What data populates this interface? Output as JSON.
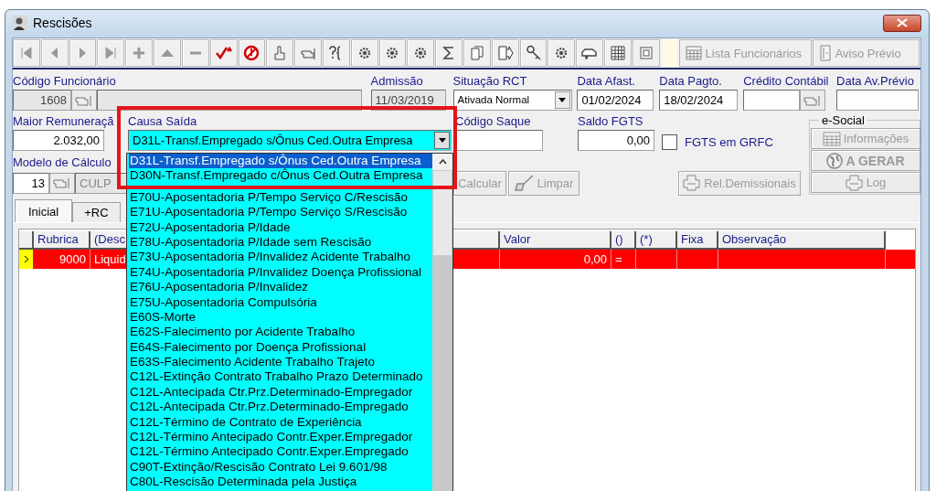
{
  "window": {
    "title": "Rescisões"
  },
  "toolbar": {
    "buttons": [
      {
        "label": "Lista Funcionários",
        "disabled": true
      },
      {
        "label": "Aviso Prévio",
        "disabled": true
      }
    ]
  },
  "codigo_funcionario": {
    "label": "Código Funcionário",
    "value": "1608"
  },
  "admissao": {
    "label": "Admissão",
    "value": "11/03/2019"
  },
  "situacao_rct": {
    "label": "Situação RCT",
    "value": "Ativada Normal"
  },
  "data_afast": {
    "label": "Data Afast.",
    "value": "01/02/2024"
  },
  "data_pagto": {
    "label": "Data Pagto.",
    "value": "18/02/2024"
  },
  "credito_contabil": {
    "label": "Crédito Contábil"
  },
  "data_av_previo": {
    "label": "Data Av.Prévio"
  },
  "maior_remuneracao": {
    "label": "Maior Remuneraçã",
    "value": "2.032,00"
  },
  "causa_saida": {
    "label": "Causa Saída",
    "value": "D31L-Transf.Empregado s/Ônus Ced.Outra Empresa",
    "expanded": true,
    "options": [
      {
        "label": "D31L-Transf.Empregado s/Ônus Ced.Outra Empresa",
        "selected": true
      },
      {
        "label": "D30N-Transf.Empregado c/Ônus Ced.Outra Empresa",
        "selected": false
      },
      {
        "label": "E70U-Aposentadoria P/Tempo Serviço C/Rescisão",
        "selected": false
      },
      {
        "label": "E71U-Aposentadoria P/Tempo Serviço S/Rescisão",
        "selected": false
      },
      {
        "label": "E72U-Aposentadoria P/Idade",
        "selected": false
      },
      {
        "label": "E78U-Aposentadoria P/Idade sem Rescisão",
        "selected": false
      },
      {
        "label": "E73U-Aposentadoria P/Invalidez Acidente Trabalho",
        "selected": false
      },
      {
        "label": "E74U-Aposentadoria P/Invalidez Doença Profissional",
        "selected": false
      },
      {
        "label": "E76U-Aposentadoria P/Invalidez",
        "selected": false
      },
      {
        "label": "E75U-Aposentadoria Compulsória",
        "selected": false
      },
      {
        "label": "E60S-Morte",
        "selected": false
      },
      {
        "label": "E62S-Falecimento por Acidente Trabalho",
        "selected": false
      },
      {
        "label": "E64S-Falecimento por Doença Profissional",
        "selected": false
      },
      {
        "label": "E63S-Falecimento Acidente Trabalho Trajeto",
        "selected": false
      },
      {
        "label": "C12L-Extinção Contrato Trabalho Prazo Determinado",
        "selected": false
      },
      {
        "label": "C12L-Antecipada Ctr.Prz.Determinado-Empregador",
        "selected": false
      },
      {
        "label": "C12L-Antecipada Ctr.Prz.Determinado-Empregado",
        "selected": false
      },
      {
        "label": "C12L-Término de Contrato de Experiência",
        "selected": false
      },
      {
        "label": "C12L-Término Antecipado Contr.Exper.Empregador",
        "selected": false
      },
      {
        "label": "C12L-Término Antecipado Contr.Exper.Empregado",
        "selected": false
      },
      {
        "label": "C90T-Extinção/Rescisão Contrato Lei 9.601/98",
        "selected": false
      },
      {
        "label": "C80L-Rescisão Determinada pela Justiça",
        "selected": false
      }
    ]
  },
  "codigo_saque": {
    "label": "Código Saque"
  },
  "saldo_fgts": {
    "label": "Saldo FGTS",
    "value": "0,00"
  },
  "fgts_grfc": {
    "label": "FGTS em GRFC",
    "checked": false
  },
  "e_social": {
    "title": "e-Social",
    "buttons": [
      {
        "label": "Informações",
        "disabled": true
      },
      {
        "label": "A GERAR",
        "disabled": true
      },
      {
        "label": "Log",
        "disabled": true
      }
    ]
  },
  "modelo_calculo": {
    "label": "Modelo de Cálculo",
    "value": "13",
    "description": "CULP"
  },
  "actions": [
    {
      "label": "Calcular",
      "disabled": true
    },
    {
      "label": "Limpar",
      "disabled": true
    },
    {
      "label": "Rel.Demissionais",
      "disabled": true
    }
  ],
  "tabs": [
    {
      "label": "Inicial",
      "selected": true
    },
    {
      "label": "+RC",
      "selected": false
    }
  ],
  "table": {
    "columns": [
      "Rubrica",
      "(Desc",
      "Valor",
      "()",
      "(*)",
      "Fixa",
      "Observação"
    ],
    "rows": [
      {
        "rubrica": "9000",
        "descricao": "Liquid",
        "valor": "0,00",
        "sinal": "=",
        "selected": true
      }
    ]
  }
}
